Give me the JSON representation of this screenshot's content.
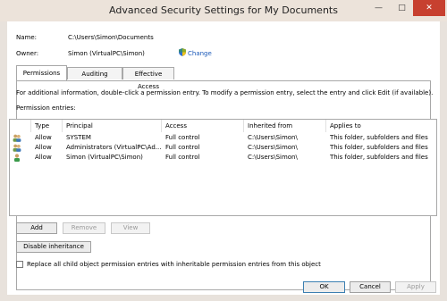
{
  "window": {
    "title": "Advanced Security Settings for My Documents",
    "min_label": "—",
    "max_label": "□",
    "close_label": "✕"
  },
  "info": {
    "name_label": "Name:",
    "name_value": "C:\\Users\\Simon\\Documents",
    "owner_label": "Owner:",
    "owner_value": "Simon (VirtualPC\\Simon)",
    "change_link": "Change"
  },
  "tabs": [
    {
      "label": "Permissions",
      "active": true
    },
    {
      "label": "Auditing",
      "active": false
    },
    {
      "label": "Effective Access",
      "active": false
    }
  ],
  "permissions": {
    "info_text": "For additional information, double-click a permission entry. To modify a permission entry, select the entry and click Edit (if available).",
    "entries_label": "Permission entries:",
    "columns": [
      "Type",
      "Principal",
      "Access",
      "Inherited from",
      "Applies to"
    ],
    "rows": [
      {
        "icon": "user-group-icon",
        "type": "Allow",
        "principal": "SYSTEM",
        "access": "Full control",
        "inherited": "C:\\Users\\Simon\\",
        "applies": "This folder, subfolders and files"
      },
      {
        "icon": "user-group-icon",
        "type": "Allow",
        "principal": "Administrators (VirtualPC\\Ad...",
        "access": "Full control",
        "inherited": "C:\\Users\\Simon\\",
        "applies": "This folder, subfolders and files"
      },
      {
        "icon": "user-icon",
        "type": "Allow",
        "principal": "Simon (VirtualPC\\Simon)",
        "access": "Full control",
        "inherited": "C:\\Users\\Simon\\",
        "applies": "This folder, subfolders and files"
      }
    ],
    "add_button": "Add",
    "remove_button": "Remove",
    "view_button": "View",
    "disable_inheritance_button": "Disable inheritance",
    "replace_checkbox_label": "Replace all child object permission entries with inheritable permission entries from this object",
    "replace_checked": false
  },
  "footer": {
    "ok": "OK",
    "cancel": "Cancel",
    "apply": "Apply"
  },
  "colors": {
    "link": "#1a58b8",
    "close_button": "#c7402f",
    "frame": "#ece3da"
  }
}
